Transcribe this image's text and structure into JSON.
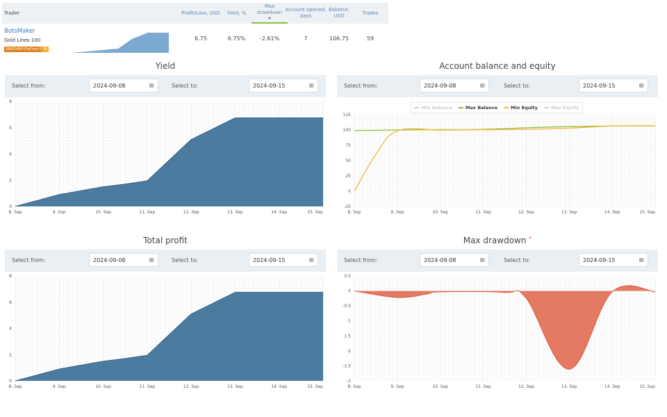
{
  "table": {
    "headers": {
      "trader": "Trader",
      "profit": "Profit/Loss, USD",
      "yield": "Yield, %",
      "drawdown": "Max drawdown",
      "opened": "Account opened, days",
      "balance": "Balance, USD",
      "trades": "Trades"
    },
    "sort_indicator": "▼",
    "row": {
      "name": "BotsMaker",
      "strategy": "Gold Lines 100",
      "badge": "38820484 ProCent 0",
      "badge_icon": "%",
      "profit": "6.75",
      "yield": "6.75%",
      "drawdown": "-2.61%",
      "opened": "7",
      "balance": "106.75",
      "trades": "59"
    }
  },
  "filters": {
    "from_label": "Select from:",
    "to_label": "Select to:",
    "from": "2024-09-08",
    "to": "2024-09-15",
    "calendar_icon": "calendar-icon"
  },
  "panels": {
    "yield": "Yield",
    "equity": "Account balance and equity",
    "profit": "Total profit",
    "drawdown": "Max drawdown",
    "drawdown_mark": "*"
  },
  "colors": {
    "area": "#41749a",
    "mini": "#7ba9cf",
    "max_balance": "#8dbd2c",
    "min_equity": "#f5b335",
    "drawdown": "#e4735a",
    "legend_off": "#cccccc"
  },
  "chart_data": [
    {
      "type": "area",
      "title": "Yield",
      "categories": [
        "8. Sep",
        "9. Sep",
        "10. Sep",
        "11. Sep",
        "12. Sep",
        "13. Sep",
        "14. Sep",
        "15. Sep"
      ],
      "x": [
        0,
        1,
        2,
        2.5,
        3,
        4,
        5,
        7
      ],
      "y": [
        0,
        0.9,
        1.5,
        1.7,
        1.95,
        5.1,
        6.75,
        6.75
      ],
      "yticks": [
        "0",
        "2",
        "4",
        "6",
        "8"
      ],
      "ylim": [
        0,
        8
      ],
      "grid": true
    },
    {
      "type": "line",
      "title": "Account balance and equity",
      "categories": [
        "8. Sep",
        "9. Sep",
        "10. Sep",
        "11. Sep",
        "12. Sep",
        "13. Sep",
        "14. Sep",
        "15. Sep"
      ],
      "yticks": [
        "-25",
        "0",
        "25",
        "50",
        "75",
        "100",
        "125"
      ],
      "ylim": [
        -25,
        125
      ],
      "grid": true,
      "legend": "top",
      "series": [
        {
          "name": "Min Balance",
          "visible": false,
          "x": [],
          "y": []
        },
        {
          "name": "Max Balance",
          "visible": true,
          "x": [
            0,
            1,
            2,
            3,
            4,
            5,
            6,
            7
          ],
          "y": [
            99,
            100,
            100.5,
            101,
            103.5,
            105.5,
            106.5,
            106.75
          ]
        },
        {
          "name": "Min Equity",
          "visible": true,
          "x": [
            0,
            0.5,
            1,
            2,
            3,
            4,
            5,
            6,
            7
          ],
          "y": [
            0,
            60,
            98.5,
            100,
            100.5,
            101,
            103,
            106.5,
            106.75
          ]
        },
        {
          "name": "Max Equity",
          "visible": false,
          "x": [],
          "y": []
        }
      ]
    },
    {
      "type": "area",
      "title": "Total profit",
      "categories": [
        "8. Sep",
        "9. Sep",
        "10. Sep",
        "11. Sep",
        "12. Sep",
        "13. Sep",
        "14. Sep",
        "15. Sep"
      ],
      "x": [
        0,
        1,
        2,
        2.5,
        3,
        4,
        5,
        7
      ],
      "y": [
        0,
        0.9,
        1.5,
        1.7,
        1.95,
        5.1,
        6.75,
        6.75
      ],
      "yticks": [
        "0",
        "2",
        "4",
        "6",
        "8"
      ],
      "ylim": [
        0,
        8
      ],
      "grid": true
    },
    {
      "type": "area",
      "title": "Max drawdown",
      "categories": [
        "8. Sep",
        "9. Sep",
        "10. Sep",
        "11. Sep",
        "12. Sep",
        "13. Sep",
        "14. Sep",
        "15. Sep"
      ],
      "x": [
        0,
        1,
        1.7,
        2,
        3.5,
        4,
        5,
        6,
        7
      ],
      "y": [
        0,
        -0.22,
        -0.1,
        -0.03,
        -0.05,
        -0.25,
        -2.61,
        -0.03,
        -0.03
      ],
      "yticks": [
        "-3",
        "-2.5",
        "-2",
        "-1.5",
        "-1",
        "-0.5",
        "0",
        "0.5"
      ],
      "ylim": [
        -3,
        0.5
      ],
      "grid": true
    }
  ]
}
